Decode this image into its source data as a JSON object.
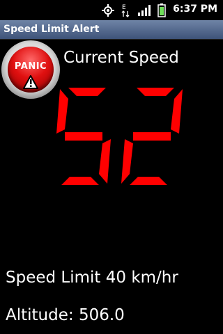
{
  "status_bar": {
    "time": "6:37 PM",
    "icons": [
      "gps-icon",
      "data-edge-icon",
      "signal-icon",
      "battery-icon"
    ],
    "network_label": "E"
  },
  "app": {
    "title": "Speed Limit Alert"
  },
  "panic_button": {
    "label": "PANIC",
    "icon": "warning-icon",
    "color": "#e01010"
  },
  "speed": {
    "label": "Current Speed",
    "value": "52",
    "digit_color": "#ff0000"
  },
  "limit": {
    "text": "Speed Limit 40 km/hr"
  },
  "altitude": {
    "text": "Altitude: 506.0"
  }
}
